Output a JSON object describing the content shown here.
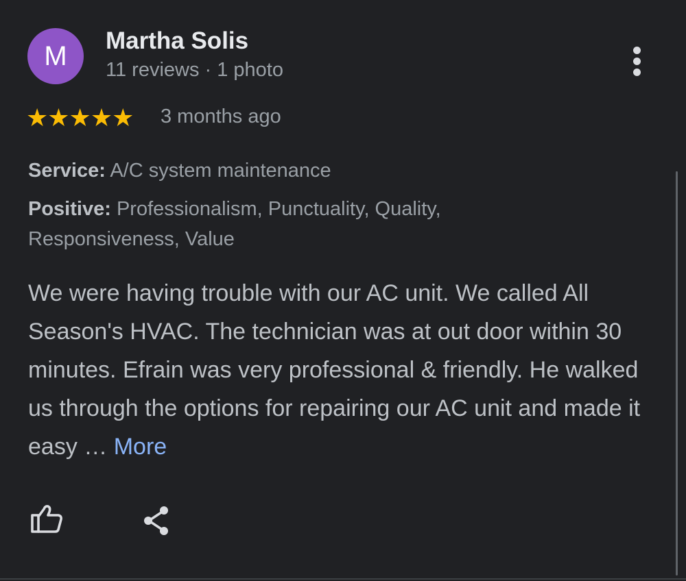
{
  "review": {
    "author": {
      "initial": "M",
      "name": "Martha Solis",
      "meta": "11 reviews · 1 photo",
      "avatar_color": "#8e55c7"
    },
    "rating": 5,
    "rating_max": 5,
    "stars": "★★★★★",
    "time_ago": "3 months ago",
    "service_label": "Service:",
    "service_value": "A/C system maintenance",
    "positive_label": "Positive:",
    "positive_value": "Professionalism, Punctuality, Quality, Responsiveness, Value",
    "text": "We were having trouble with our AC unit. We called All Season's HVAC. The technician was at out door within 30 minutes. Efrain was very professional & friendly. He walked us through the options for repairing our AC unit and made it easy … ",
    "more_label": "More"
  },
  "actions": {
    "like_icon": "thumbs-up-icon",
    "share_icon": "share-icon",
    "menu_icon": "more-vertical-icon"
  },
  "colors": {
    "background": "#202124",
    "star": "#fbbc04",
    "link": "#8ab4f8"
  }
}
